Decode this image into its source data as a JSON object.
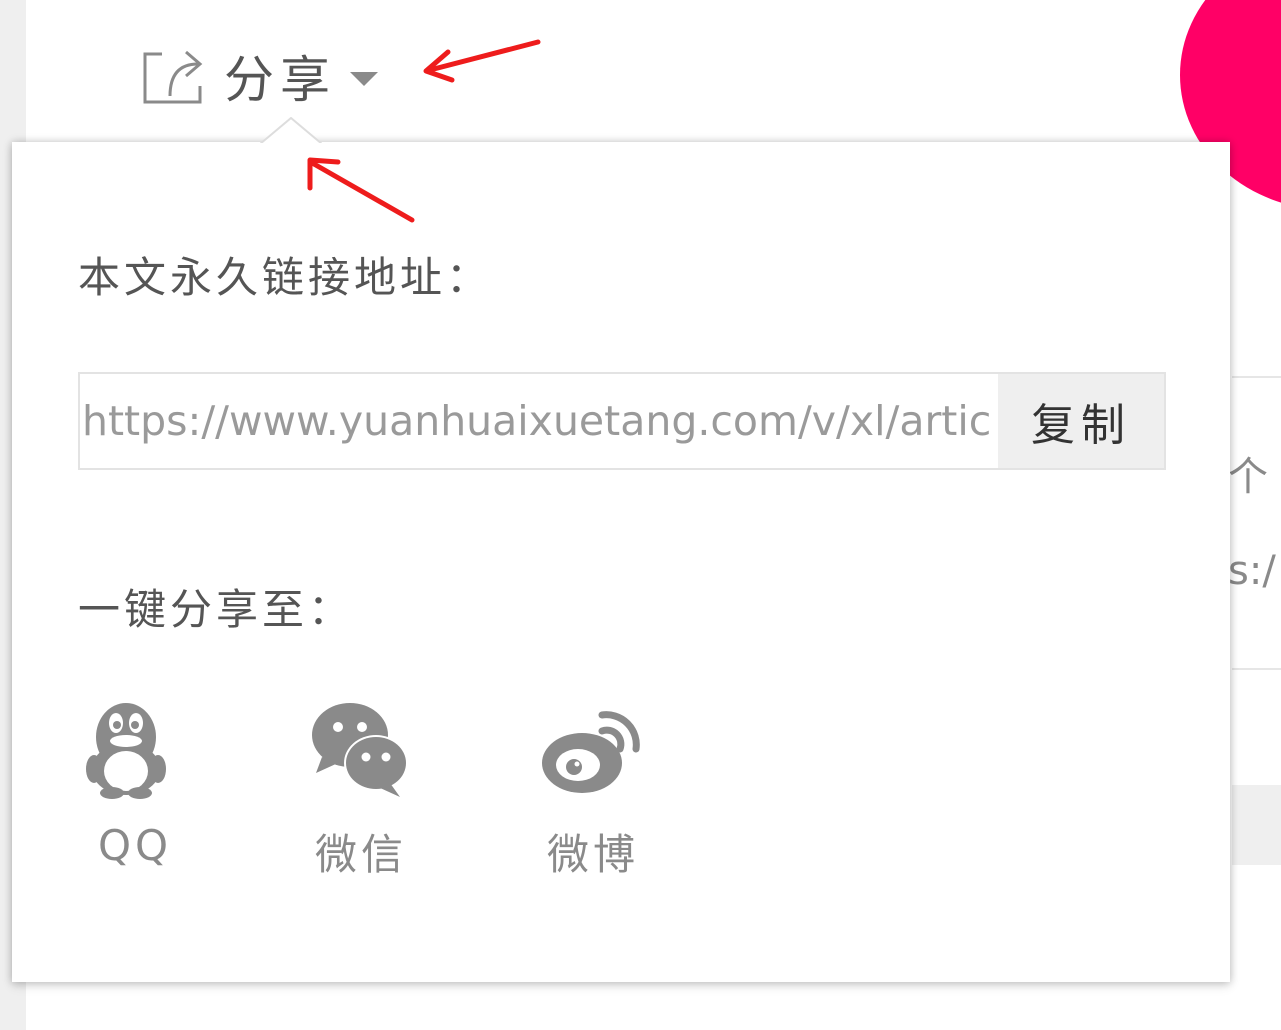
{
  "share": {
    "label": "分享",
    "icon": "share-icon",
    "caret": "caret-down-icon"
  },
  "popup": {
    "link_label": "本文永久链接地址：",
    "link_url": "https://www.yuanhuaixuetang.com/v/xl/artic",
    "copy_label": "复制",
    "share_to_label": "一键分享至：",
    "targets": [
      {
        "label": "QQ",
        "icon": "qq-penguin-icon"
      },
      {
        "label": "微信",
        "icon": "wechat-icon"
      },
      {
        "label": "微博",
        "icon": "weibo-icon"
      }
    ]
  },
  "background": {
    "text1": "个",
    "text2": "s:/",
    "accent_color": "#ff0066"
  },
  "annotations": {
    "arrow_color": "#ee1c1c"
  }
}
